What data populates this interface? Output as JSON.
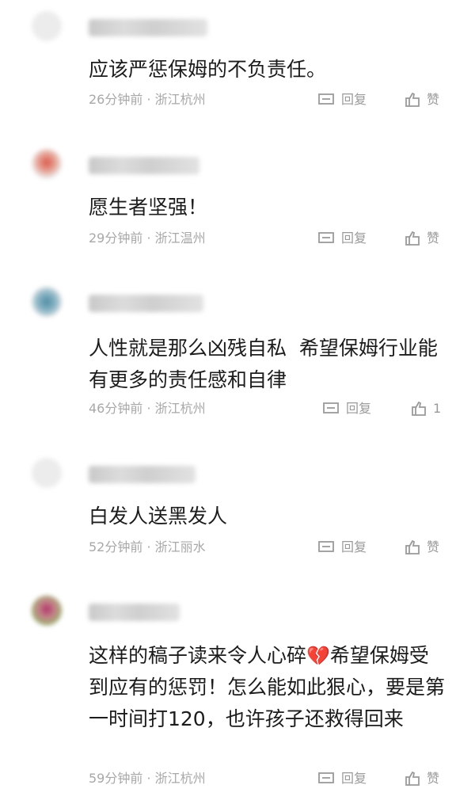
{
  "comments": [
    {
      "avatar_color": "#ececec",
      "content": "应该严惩保姆的不负责任。",
      "time": "26分钟前",
      "separator": " · ",
      "location": "浙江杭州",
      "reply_label": "回复",
      "like_label": "赞"
    },
    {
      "avatar_color": "#d98a7a",
      "content": "愿生者坚强！",
      "time": "29分钟前",
      "separator": " · ",
      "location": "浙江温州",
      "reply_label": "回复",
      "like_label": "赞"
    },
    {
      "avatar_color": "#6fa3b8",
      "content": "人性就是那么凶残自私  希望保姆行业能有更多的责任感和自律",
      "time": "46分钟前",
      "separator": " · ",
      "location": "浙江杭州",
      "reply_label": "回复",
      "like_label": "1"
    },
    {
      "avatar_color": "#ececec",
      "content": "白发人送黑发人",
      "time": "52分钟前",
      "separator": " · ",
      "location": "浙江丽水",
      "reply_label": "回复",
      "like_label": "赞"
    },
    {
      "avatar_color": "#b98a8a",
      "content_before": "这样的稿子读来令人心碎",
      "emoji": "💔",
      "content_after": "希望保姆受到应有的惩罚！怎么能如此狠心，要是第一时间打120，也许孩子还救得回来",
      "time": "59分钟前",
      "separator": " · ",
      "location": "浙江杭州",
      "reply_label": "回复",
      "like_label": "赞"
    }
  ]
}
